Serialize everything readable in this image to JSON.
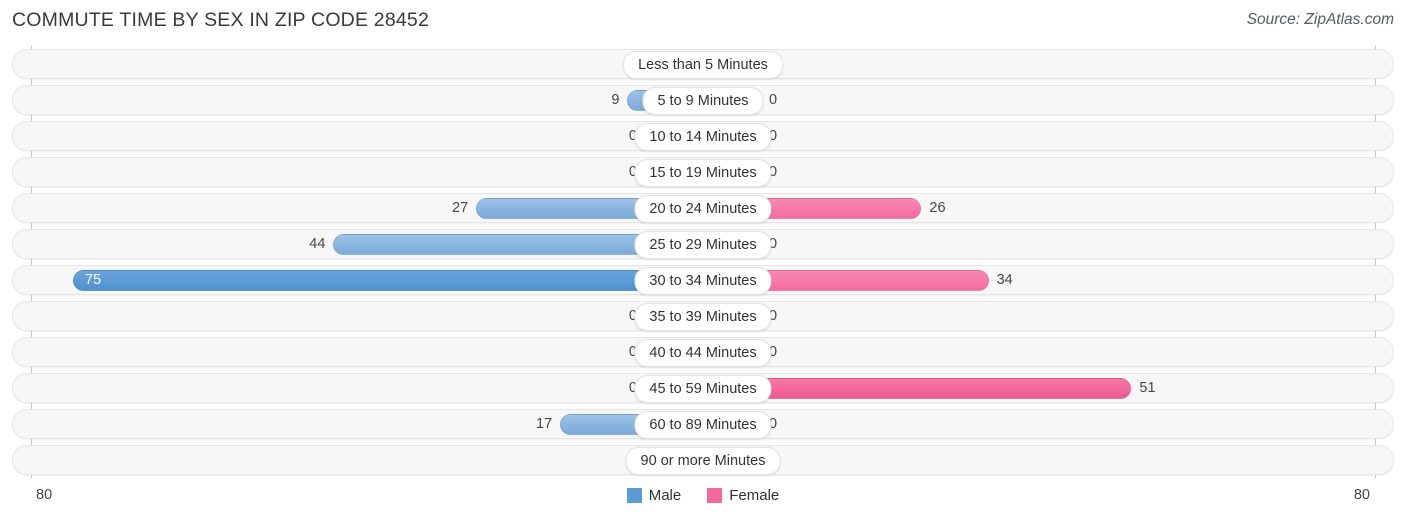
{
  "header": {
    "title": "COMMUTE TIME BY SEX IN ZIP CODE 28452",
    "source": "Source: ZipAtlas.com"
  },
  "axis": {
    "left_tick": "80",
    "right_tick": "80"
  },
  "legend": {
    "items": [
      {
        "label": "Male",
        "color": "#5b9bd5"
      },
      {
        "label": "Female",
        "color": "#f2689c"
      }
    ]
  },
  "chart_data": {
    "type": "bar",
    "orientation": "horizontal-diverging",
    "title": "COMMUTE TIME BY SEX IN ZIP CODE 28452",
    "xlabel": "",
    "ylabel": "",
    "xlim": [
      80,
      80
    ],
    "axis_max": 80,
    "grid": false,
    "legend_position": "bottom-center",
    "categories": [
      "Less than 5 Minutes",
      "5 to 9 Minutes",
      "10 to 14 Minutes",
      "15 to 19 Minutes",
      "20 to 24 Minutes",
      "25 to 29 Minutes",
      "30 to 34 Minutes",
      "35 to 39 Minutes",
      "40 to 44 Minutes",
      "45 to 59 Minutes",
      "60 to 89 Minutes",
      "90 or more Minutes"
    ],
    "series": [
      {
        "name": "Male",
        "color": "#5b9bd5",
        "values": [
          0,
          9,
          0,
          0,
          27,
          44,
          75,
          0,
          0,
          0,
          17,
          0
        ]
      },
      {
        "name": "Female",
        "color": "#f2689c",
        "values": [
          0,
          0,
          0,
          0,
          26,
          0,
          34,
          0,
          0,
          51,
          0,
          0
        ]
      }
    ],
    "rows": [
      {
        "label": "Less than 5 Minutes",
        "male": "0",
        "female": "0",
        "male_value": 0,
        "female_value": 0
      },
      {
        "label": "5 to 9 Minutes",
        "male": "9",
        "female": "0",
        "male_value": 9,
        "female_value": 0
      },
      {
        "label": "10 to 14 Minutes",
        "male": "0",
        "female": "0",
        "male_value": 0,
        "female_value": 0
      },
      {
        "label": "15 to 19 Minutes",
        "male": "0",
        "female": "0",
        "male_value": 0,
        "female_value": 0
      },
      {
        "label": "20 to 24 Minutes",
        "male": "27",
        "female": "26",
        "male_value": 27,
        "female_value": 26
      },
      {
        "label": "25 to 29 Minutes",
        "male": "44",
        "female": "0",
        "male_value": 44,
        "female_value": 0
      },
      {
        "label": "30 to 34 Minutes",
        "male": "75",
        "female": "34",
        "male_value": 75,
        "female_value": 34
      },
      {
        "label": "35 to 39 Minutes",
        "male": "0",
        "female": "0",
        "male_value": 0,
        "female_value": 0
      },
      {
        "label": "40 to 44 Minutes",
        "male": "0",
        "female": "0",
        "male_value": 0,
        "female_value": 0
      },
      {
        "label": "45 to 59 Minutes",
        "male": "0",
        "female": "51",
        "male_value": 0,
        "female_value": 51
      },
      {
        "label": "60 to 89 Minutes",
        "male": "17",
        "female": "0",
        "male_value": 17,
        "female_value": 0
      },
      {
        "label": "90 or more Minutes",
        "male": "0",
        "female": "0",
        "male_value": 0,
        "female_value": 0
      }
    ]
  }
}
